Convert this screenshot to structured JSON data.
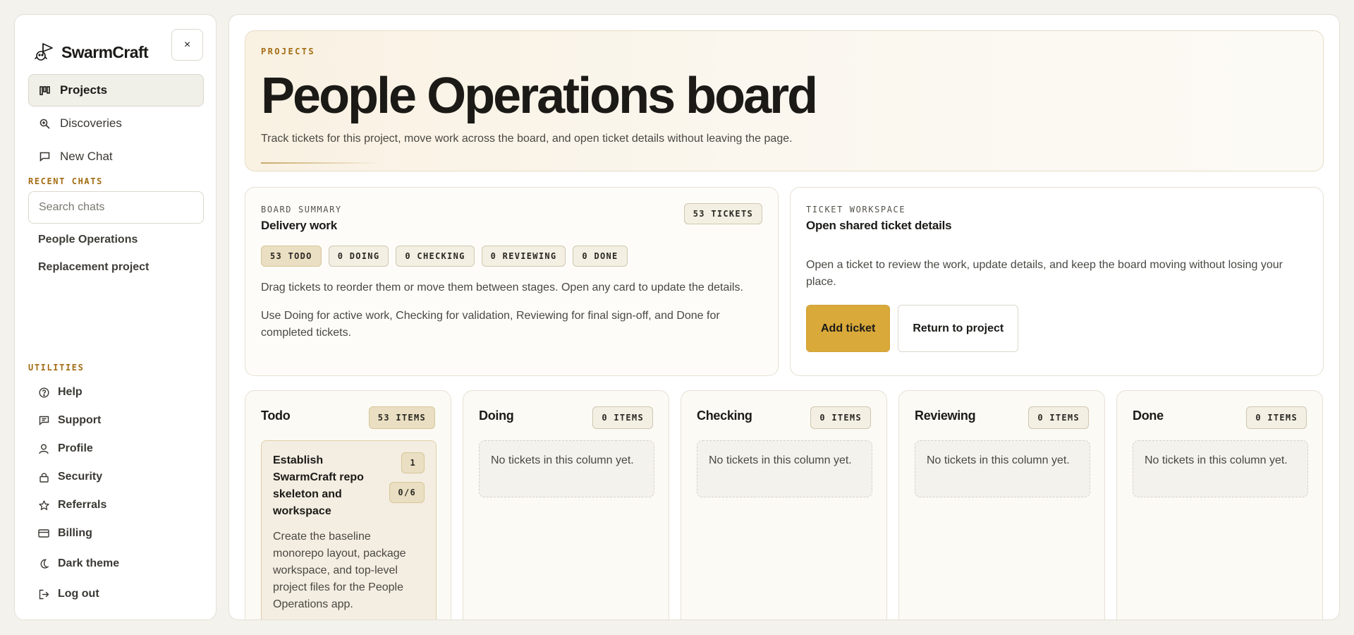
{
  "brand": {
    "name": "SwarmCraft",
    "close_label": "×"
  },
  "nav": {
    "items": [
      {
        "label": "Projects",
        "icon": "board-icon",
        "active": true
      },
      {
        "label": "Discoveries",
        "icon": "search-zoom-icon",
        "active": false
      },
      {
        "label": "New Chat",
        "icon": "chat-icon",
        "active": false
      }
    ]
  },
  "recent": {
    "label": "RECENT CHATS",
    "search_placeholder": "Search chats",
    "items": [
      "People Operations",
      "Replacement project"
    ]
  },
  "utilities": {
    "label": "UTILITIES",
    "items": [
      {
        "label": "Help",
        "icon": "help-icon"
      },
      {
        "label": "Support",
        "icon": "support-icon"
      },
      {
        "label": "Profile",
        "icon": "profile-icon"
      },
      {
        "label": "Security",
        "icon": "lock-icon"
      },
      {
        "label": "Referrals",
        "icon": "star-icon"
      },
      {
        "label": "Billing",
        "icon": "card-icon"
      },
      {
        "label": "Dark theme",
        "icon": "moon-icon"
      },
      {
        "label": "Log out",
        "icon": "logout-icon"
      }
    ]
  },
  "hero": {
    "eyebrow": "PROJECTS",
    "title": "People Operations board",
    "subtitle": "Track tickets for this project, move work across the board, and open ticket details without leaving the page."
  },
  "summary": {
    "eyebrow": "BOARD SUMMARY",
    "title": "Delivery work",
    "tickets": "53 TICKETS",
    "pills": [
      "53 TODO",
      "0 DOING",
      "0 CHECKING",
      "0 REVIEWING",
      "0 DONE"
    ],
    "text1": "Drag tickets to reorder them or move them between stages. Open any card to update the details.",
    "text2": "Use Doing for active work, Checking for validation, Reviewing for final sign-off, and Done for completed tickets."
  },
  "workspace": {
    "eyebrow": "TICKET WORKSPACE",
    "title": "Open shared ticket details",
    "text": "Open a ticket to review the work, update details, and keep the board moving without losing your place.",
    "primary": "Add ticket",
    "secondary": "Return to project"
  },
  "columns": [
    {
      "title": "Todo",
      "count": "53 ITEMS"
    },
    {
      "title": "Doing",
      "count": "0 ITEMS",
      "empty": "No tickets in this column yet."
    },
    {
      "title": "Checking",
      "count": "0 ITEMS",
      "empty": "No tickets in this column yet."
    },
    {
      "title": "Reviewing",
      "count": "0 ITEMS",
      "empty": "No tickets in this column yet."
    },
    {
      "title": "Done",
      "count": "0 ITEMS",
      "empty": "No tickets in this column yet."
    }
  ],
  "ticket": {
    "title": "Establish SwarmCraft repo skeleton and workspace",
    "number": "1",
    "progress": "0/6",
    "description": "Create the baseline monorepo layout, package workspace, and top-level project files for the People Operations app."
  }
}
